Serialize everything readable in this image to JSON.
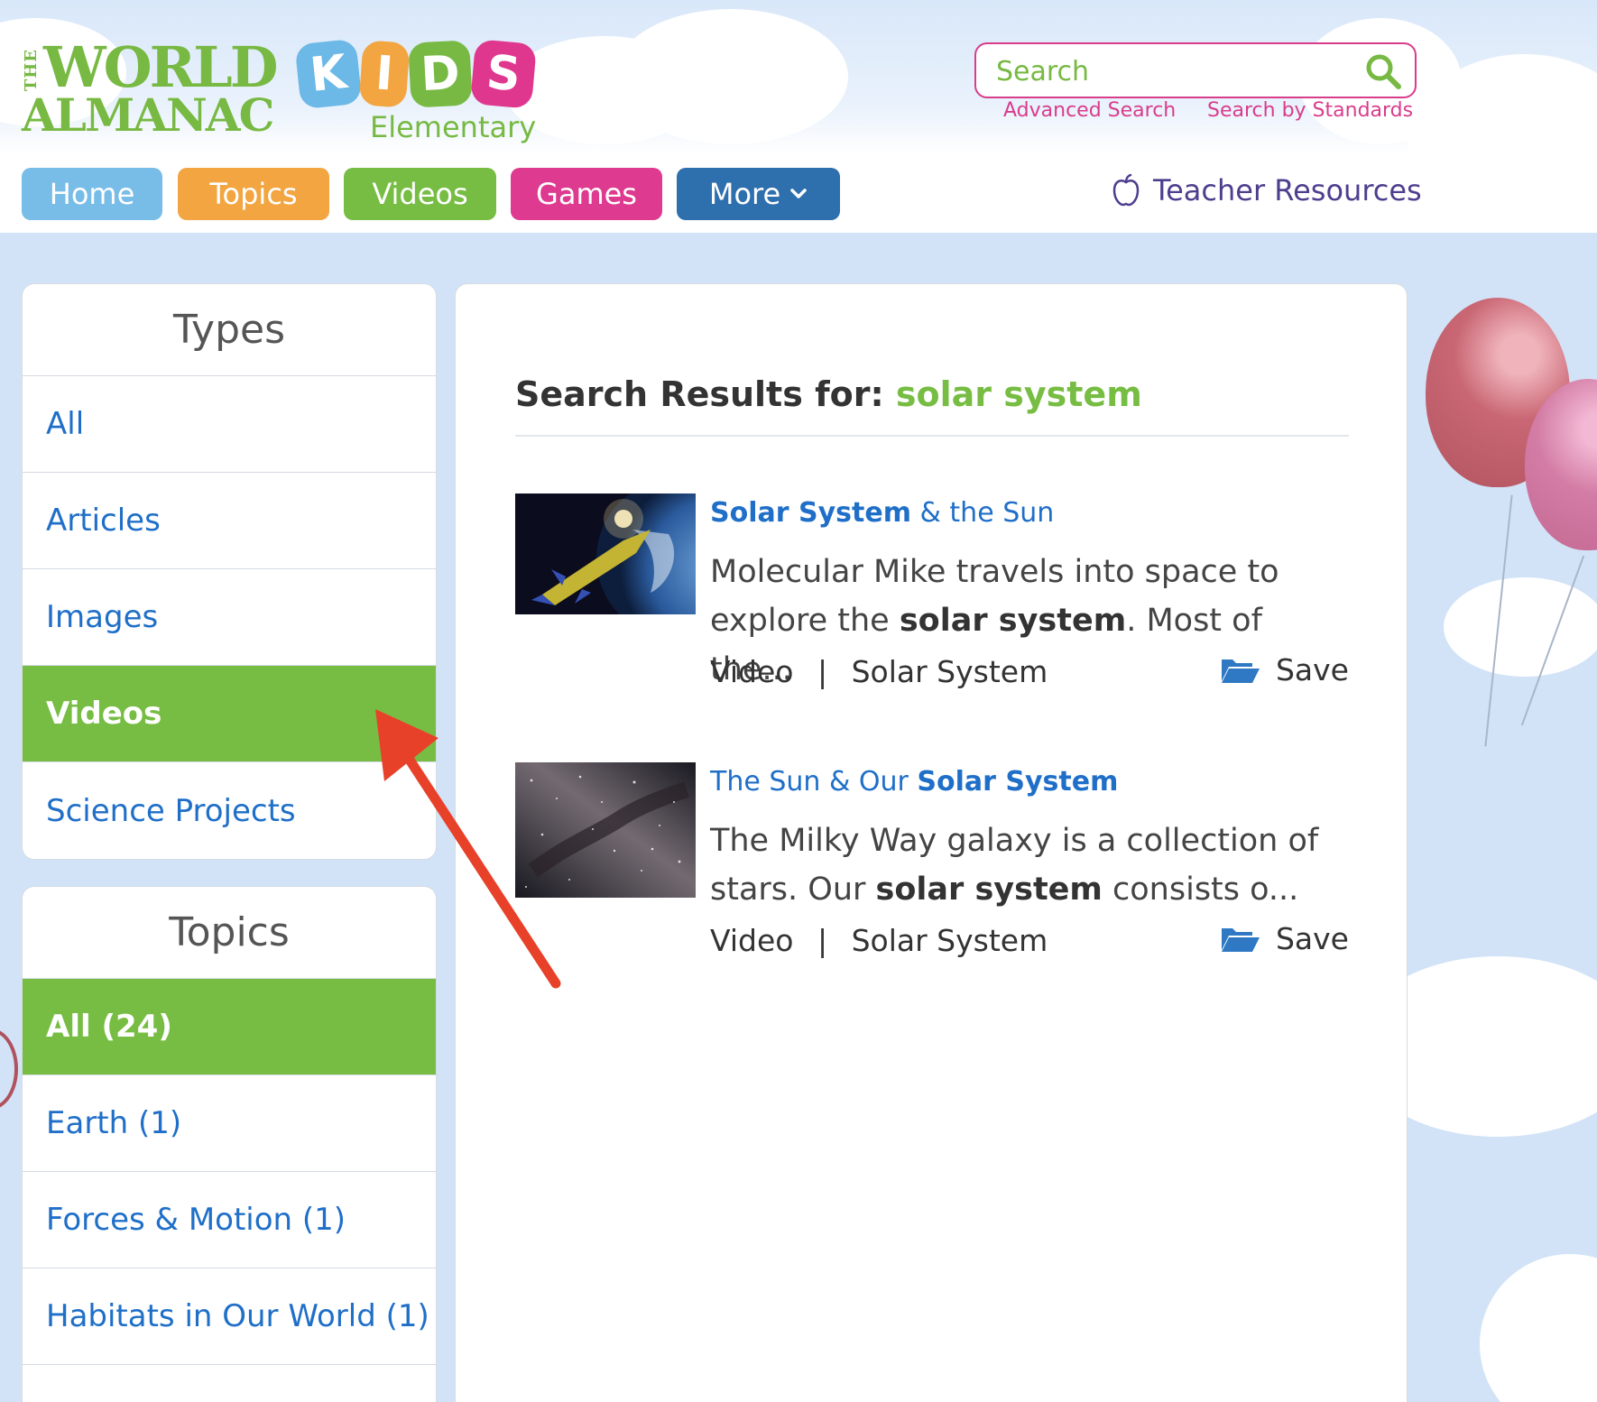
{
  "logo": {
    "the": "THE",
    "world": "WORLD",
    "almanac": "ALMANAC",
    "kids": [
      "K",
      "I",
      "D",
      "S"
    ],
    "kids_colors": [
      "#6cb8e6",
      "#f2a541",
      "#77b943",
      "#e0378e"
    ],
    "elementary": "Elementary"
  },
  "search": {
    "placeholder": "Search",
    "advanced_label": "Advanced Search",
    "standards_label": "Search by Standards"
  },
  "nav": {
    "items": [
      {
        "label": "Home",
        "color": "#78bde8"
      },
      {
        "label": "Topics",
        "color": "#f2a541"
      },
      {
        "label": "Videos",
        "color": "#77bd43"
      },
      {
        "label": "Games",
        "color": "#de3a8f"
      },
      {
        "label": "More",
        "color": "#2e6fae"
      }
    ],
    "teacher_label": "Teacher Resources"
  },
  "types": {
    "title": "Types",
    "items": [
      {
        "label": "All",
        "active": false
      },
      {
        "label": "Articles",
        "active": false
      },
      {
        "label": "Images",
        "active": false
      },
      {
        "label": "Videos",
        "active": true
      },
      {
        "label": "Science Projects",
        "active": false
      }
    ]
  },
  "topics": {
    "title": "Topics",
    "items": [
      {
        "label": "All (24)",
        "active": true
      },
      {
        "label": "Earth (1)",
        "active": false
      },
      {
        "label": "Forces & Motion (1)",
        "active": false
      },
      {
        "label": "Habitats in Our World (1)",
        "active": false
      }
    ]
  },
  "results": {
    "heading": "Search Results for:",
    "query": "solar system",
    "items": [
      {
        "title_bold": "Solar System",
        "title_rest": " & the Sun",
        "desc_pre": "Molecular Mike travels into space to explore the ",
        "desc_bold": "solar system",
        "desc_post": ". Most of the...",
        "type": "Video",
        "separator": "|",
        "topic": "Solar System",
        "save_label": "Save"
      },
      {
        "title_pre": "The Sun & Our ",
        "title_bold": "Solar System",
        "desc_pre": "The Milky Way galaxy is a collection of stars. Our ",
        "desc_bold": "solar system",
        "desc_post": " consists o...",
        "type": "Video",
        "separator": "|",
        "topic": "Solar System",
        "save_label": "Save"
      }
    ]
  },
  "colors": {
    "active_green": "#77bd43",
    "link_blue": "#1f6fc8",
    "accent_pink": "#d83c8c",
    "annotation_red": "#e8412a"
  }
}
